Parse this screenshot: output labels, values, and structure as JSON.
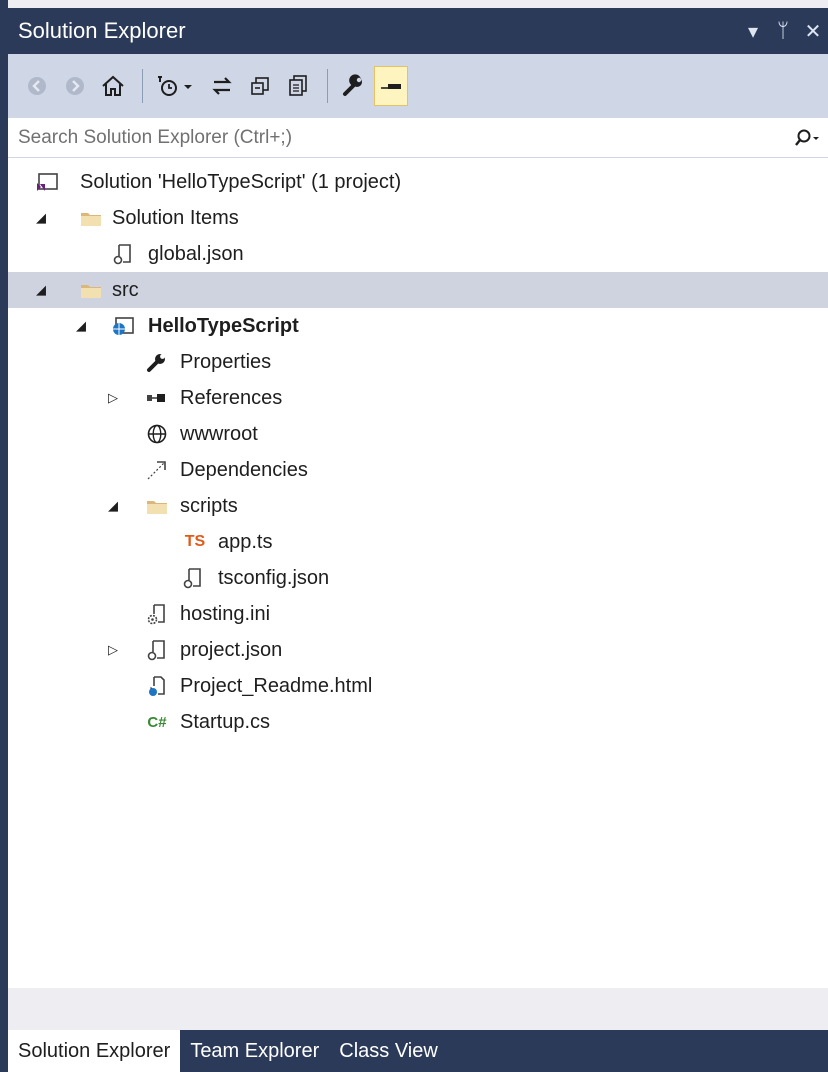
{
  "window": {
    "title": "Solution Explorer",
    "controls": {
      "dropdown": "▾",
      "pin": "ᛘ",
      "close": "✕"
    }
  },
  "toolbar": {
    "buttons": [
      "back-icon",
      "forward-icon",
      "home-icon",
      "pending-changes-icon",
      "sync-icon",
      "collapse-all-icon",
      "show-all-files-icon",
      "properties-icon",
      "preview-selected-icon"
    ]
  },
  "search": {
    "placeholder": "Search Solution Explorer (Ctrl+;)",
    "value": ""
  },
  "tree": {
    "solution": "Solution 'HelloTypeScript' (1 project)",
    "solution_items": "Solution Items",
    "global_json": "global.json",
    "src": "src",
    "project": "HelloTypeScript",
    "properties": "Properties",
    "references": "References",
    "wwwroot": "wwwroot",
    "dependencies": "Dependencies",
    "scripts": "scripts",
    "app_ts": "app.ts",
    "tsconfig": "tsconfig.json",
    "hosting": "hosting.ini",
    "project_json": "project.json",
    "readme": "Project_Readme.html",
    "startup": "Startup.cs",
    "ts_badge": "TS",
    "cs_badge": "C#"
  },
  "tabs": {
    "solution_explorer": "Solution Explorer",
    "team_explorer": "Team Explorer",
    "class_view": "Class View"
  },
  "colors": {
    "titlebar": "#2b3a58",
    "toolbar": "#cfd6e5",
    "selection": "#cfd3e0",
    "folder": "#dcb67a",
    "ts_orange": "#e05a1a",
    "cs_green": "#388a34"
  }
}
